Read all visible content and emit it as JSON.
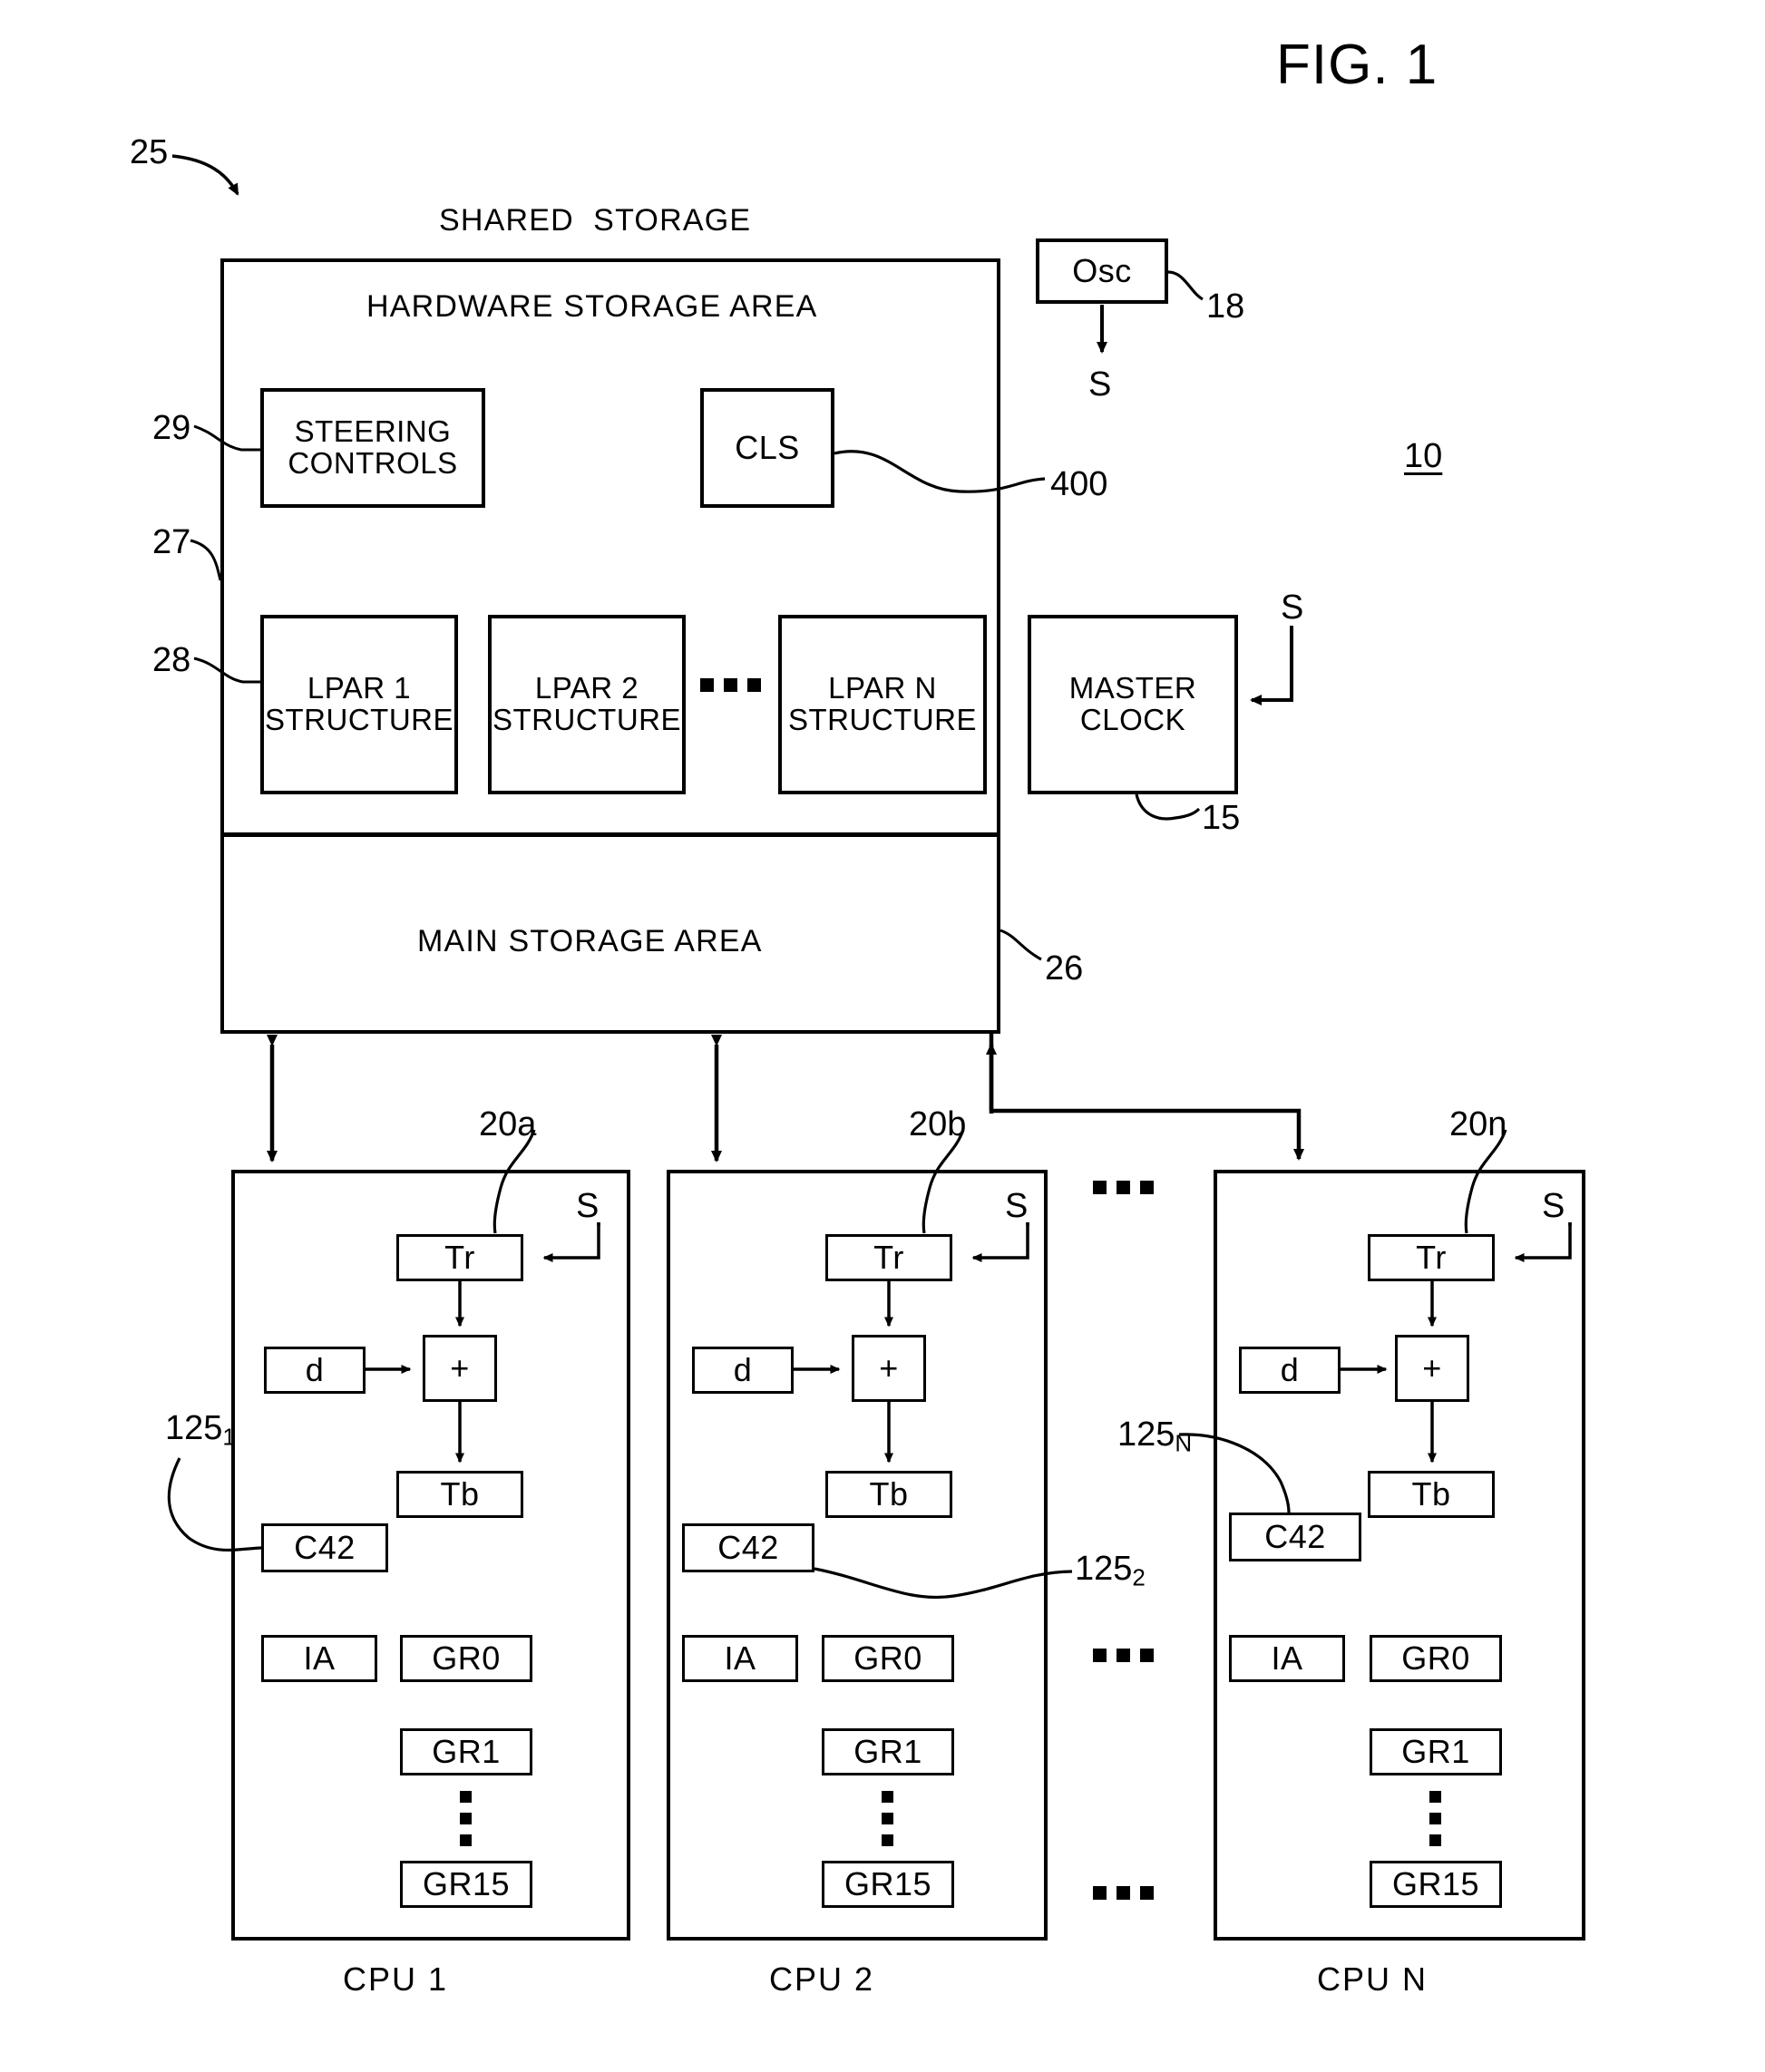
{
  "figure": {
    "title": "FIG. 1",
    "system_ref": "10",
    "assembly_ref": "25"
  },
  "shared_storage": {
    "caption": "SHARED  STORAGE",
    "hardware_area_label": "HARDWARE STORAGE AREA",
    "main_area_label": "MAIN STORAGE AREA",
    "refs": {
      "steering_controls": "29",
      "hardware_storage_area": "27",
      "lpar_group": "28",
      "main_storage_area": "26",
      "cls": "400"
    },
    "steering_controls": {
      "line1": "STEERING",
      "line2": "CONTROLS"
    },
    "cls": "CLS",
    "lpars": [
      {
        "line1": "LPAR 1",
        "line2": "STRUCTURE"
      },
      {
        "line1": "LPAR 2",
        "line2": "STRUCTURE"
      },
      {
        "line1": "LPAR N",
        "line2": "STRUCTURE"
      }
    ]
  },
  "oscillator": {
    "label": "Osc",
    "ref": "18",
    "signal": "S"
  },
  "master_clock": {
    "line1": "MASTER",
    "line2": "CLOCK",
    "ref": "15",
    "signal": "S"
  },
  "cpus": [
    {
      "caption": "CPU 1",
      "ref": "20a",
      "c42_ref_base": "125",
      "c42_ref_sub": "1",
      "signal": "S",
      "tr": "Tr",
      "d": "d",
      "adder": "+",
      "tb": "Tb",
      "c42": "C42",
      "ia": "IA",
      "gr0": "GR0",
      "gr1": "GR1",
      "gr15": "GR15"
    },
    {
      "caption": "CPU 2",
      "ref": "20b",
      "c42_ref_base": "125",
      "c42_ref_sub": "2",
      "signal": "S",
      "tr": "Tr",
      "d": "d",
      "adder": "+",
      "tb": "Tb",
      "c42": "C42",
      "ia": "IA",
      "gr0": "GR0",
      "gr1": "GR1",
      "gr15": "GR15"
    },
    {
      "caption": "CPU N",
      "ref": "20n",
      "c42_ref_base": "125",
      "c42_ref_sub": "N",
      "signal": "S",
      "tr": "Tr",
      "d": "d",
      "adder": "+",
      "tb": "Tb",
      "c42": "C42",
      "ia": "IA",
      "gr0": "GR0",
      "gr1": "GR1",
      "gr15": "GR15"
    }
  ],
  "colors": {
    "ink": "#000000",
    "paper": "#ffffff"
  }
}
